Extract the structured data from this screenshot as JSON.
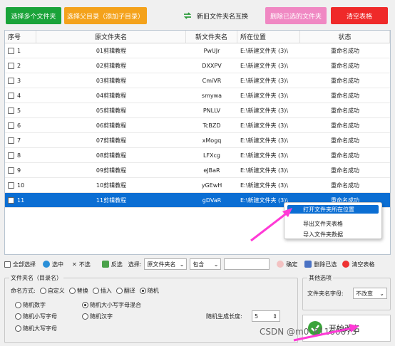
{
  "toolbar_top": {
    "select_folders": "选择多个文件夹",
    "select_parent": "选择父目录（添加子目录）",
    "swap_names": "新旧文件夹名互换",
    "delete_selected_folders": "删除已选的文件夹",
    "clear_table": "清空表格",
    "colors": {
      "green": "#1aa339",
      "orange": "#f4a21b",
      "pink": "#f088c3",
      "red": "#ef2929"
    }
  },
  "table": {
    "headers": [
      "序号",
      "原文件夹名",
      "新文件夹名",
      "所在位置",
      "状态"
    ],
    "rows": [
      {
        "no": "1",
        "old": "01剪辑教程",
        "new": "PwUJr",
        "loc": "E:\\新建文件夹 (3)\\",
        "status": "重命名成功"
      },
      {
        "no": "2",
        "old": "02剪辑教程",
        "new": "DXXPV",
        "loc": "E:\\新建文件夹 (3)\\",
        "status": "重命名成功"
      },
      {
        "no": "3",
        "old": "03剪辑教程",
        "new": "CmiVR",
        "loc": "E:\\新建文件夹 (3)\\",
        "status": "重命名成功"
      },
      {
        "no": "4",
        "old": "04剪辑教程",
        "new": "smywa",
        "loc": "E:\\新建文件夹 (3)\\",
        "status": "重命名成功"
      },
      {
        "no": "5",
        "old": "05剪辑教程",
        "new": "PNLLV",
        "loc": "E:\\新建文件夹 (3)\\",
        "status": "重命名成功"
      },
      {
        "no": "6",
        "old": "06剪辑教程",
        "new": "TcBZD",
        "loc": "E:\\新建文件夹 (3)\\",
        "status": "重命名成功"
      },
      {
        "no": "7",
        "old": "07剪辑教程",
        "new": "xMogq",
        "loc": "E:\\新建文件夹 (3)\\",
        "status": "重命名成功"
      },
      {
        "no": "8",
        "old": "08剪辑教程",
        "new": "LFXcg",
        "loc": "E:\\新建文件夹 (3)\\",
        "status": "重命名成功"
      },
      {
        "no": "9",
        "old": "09剪辑教程",
        "new": "eJBaR",
        "loc": "E:\\新建文件夹 (3)\\",
        "status": "重命名成功"
      },
      {
        "no": "10",
        "old": "10剪辑教程",
        "new": "yGEwH",
        "loc": "E:\\新建文件夹 (3)\\",
        "status": "重命名成功"
      },
      {
        "no": "11",
        "old": "11剪辑教程",
        "new": "gDVaR",
        "loc": "E:\\新建文件夹 (3)\\",
        "status": "重命名成功",
        "selected": true
      }
    ]
  },
  "context_menu": {
    "items": [
      "打开文件夹所在位置",
      "导出文件夹表格",
      "导入文件夹数据"
    ]
  },
  "toolbar_bottom": {
    "select_all": "全部选择",
    "check": "选中",
    "uncheck": "不选",
    "invert": "反选",
    "choose_label": "选择:",
    "field_value": "原文件夹名",
    "mode_value": "包含",
    "filter_value": "",
    "confirm": "确定",
    "delete_selected": "删除已选",
    "clear_table": "清空表格"
  },
  "folder_name": {
    "legend": "文件夹名（目录名）",
    "mode_label": "命名方式:",
    "modes": [
      "自定义",
      "替换",
      "插入",
      "翻译",
      "随机"
    ],
    "random_options": [
      "随机数字",
      "随机大小写字母混合",
      "随机小写字母",
      "随机汉字",
      "随机大写字母"
    ],
    "length_label": "随机生成长度:",
    "length_value": "5"
  },
  "other_options": {
    "legend": "其他选项",
    "case_label": "文件夹名字母:",
    "case_value": "不改变"
  },
  "start_button": "开始改名",
  "watermark": "CSDN @m0_61166673"
}
